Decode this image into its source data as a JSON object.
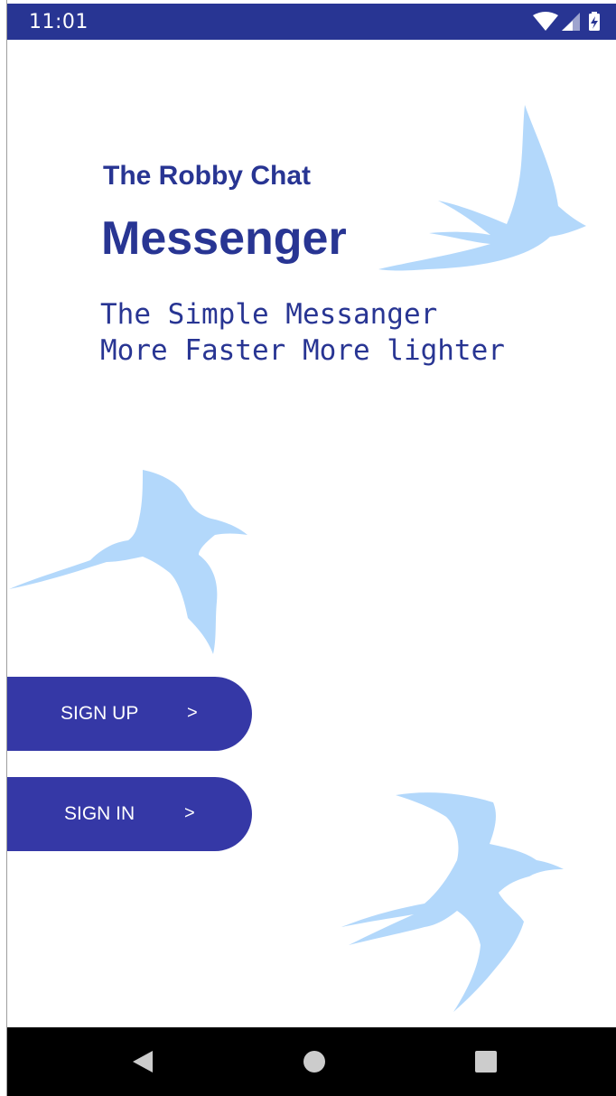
{
  "status_bar": {
    "time": "11:01",
    "icons": [
      "wifi-icon",
      "cell-signal-icon",
      "battery-charging-icon"
    ],
    "background": "#283593"
  },
  "welcome": {
    "subtitle": "The Robby Chat",
    "title": "Messenger",
    "tagline": "The Simple Messanger\nMore Faster More lighter"
  },
  "actions": {
    "signup_label": "SIGN UP",
    "signup_chevron": ">",
    "signin_label": "SIGN IN",
    "signin_chevron": ">"
  },
  "nav_bar": {
    "icons": [
      "back-triangle-icon",
      "home-circle-icon",
      "recents-square-icon"
    ]
  },
  "colors": {
    "primary": "#283593",
    "button": "#3538a6",
    "bird": "#b3d8fb"
  }
}
